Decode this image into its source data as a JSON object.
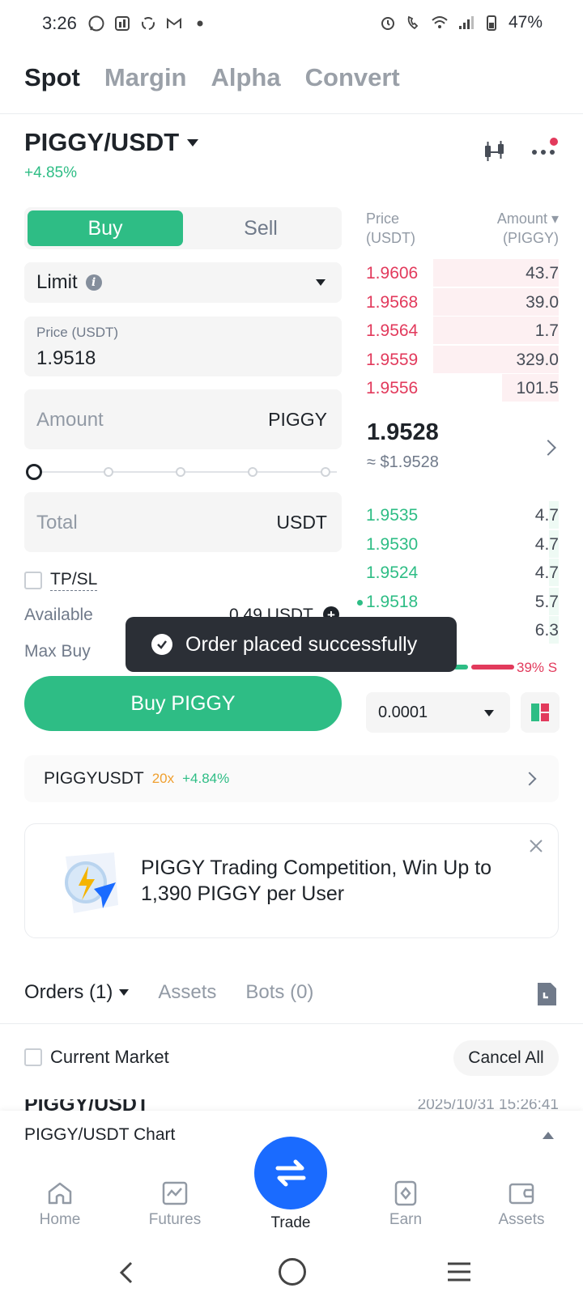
{
  "status_bar": {
    "time": "3:26",
    "battery": "47%"
  },
  "top_tabs": [
    "Spot",
    "Margin",
    "Alpha",
    "Convert"
  ],
  "pair": {
    "symbol": "PIGGY/USDT",
    "change": "+4.85%"
  },
  "form": {
    "buy_label": "Buy",
    "sell_label": "Sell",
    "order_type": "Limit",
    "price_label": "Price (USDT)",
    "price_value": "1.9518",
    "amount_placeholder": "Amount",
    "amount_unit": "PIGGY",
    "total_placeholder": "Total",
    "total_unit": "USDT",
    "slider_level": 0,
    "tpsl_label": "TP/SL",
    "available_label": "Available",
    "available_value": "0.49 USDT",
    "maxbuy_label": "Max Buy",
    "buy_button": "Buy PIGGY"
  },
  "orderbook": {
    "price_header": [
      "Price",
      "(USDT)"
    ],
    "amount_header": [
      "Amount ▾",
      "(PIGGY)"
    ],
    "asks": [
      {
        "price": "1.9606",
        "amount": "43.7",
        "depth": 0.62
      },
      {
        "price": "1.9568",
        "amount": "39.0",
        "depth": 0.62
      },
      {
        "price": "1.9564",
        "amount": "1.7",
        "depth": 0.62
      },
      {
        "price": "1.9559",
        "amount": "329.0",
        "depth": 0.62
      },
      {
        "price": "1.9556",
        "amount": "101.5",
        "depth": 0.28
      }
    ],
    "last_price": "1.9528",
    "last_usd": "≈ $1.9528",
    "bids": [
      {
        "price": "1.9535",
        "amount": "4.7",
        "depth": 0.05
      },
      {
        "price": "1.9530",
        "amount": "4.7",
        "depth": 0.05
      },
      {
        "price": "1.9524",
        "amount": "4.7",
        "depth": 0.05
      },
      {
        "price": "1.9518",
        "amount": "5.7",
        "depth": 0.05,
        "mine": true
      },
      {
        "price": "",
        "amount": "6.3",
        "depth": 0.05
      }
    ],
    "sell_ratio": "39% S",
    "precision": "0.0001"
  },
  "toast": {
    "message": "Order placed successfully"
  },
  "futures_link": {
    "symbol": "PIGGYUSDT",
    "leverage": "20x",
    "change": "+4.84%"
  },
  "banner": {
    "text": "PIGGY Trading Competition, Win Up to 1,390 PIGGY per User"
  },
  "orders": {
    "tabs": [
      "Orders (1)",
      "Assets",
      "Bots (0)"
    ],
    "current_market_label": "Current Market",
    "cancel_all": "Cancel All",
    "row_pair": "PIGGY/USDT",
    "row_time": "2025/10/31 15:26:41"
  },
  "chart_drawer": {
    "label": "PIGGY/USDT Chart"
  },
  "bottom_nav": [
    {
      "label": "Home",
      "icon": "home-icon"
    },
    {
      "label": "Futures",
      "icon": "futures-icon"
    },
    {
      "label": "Trade",
      "icon": "trade-swap-icon"
    },
    {
      "label": "Earn",
      "icon": "earn-icon"
    },
    {
      "label": "Assets",
      "icon": "wallet-icon"
    }
  ],
  "colors": {
    "buy": "#2ebd85",
    "sell": "#e23a5c",
    "trade_fab": "#1a6bff"
  }
}
